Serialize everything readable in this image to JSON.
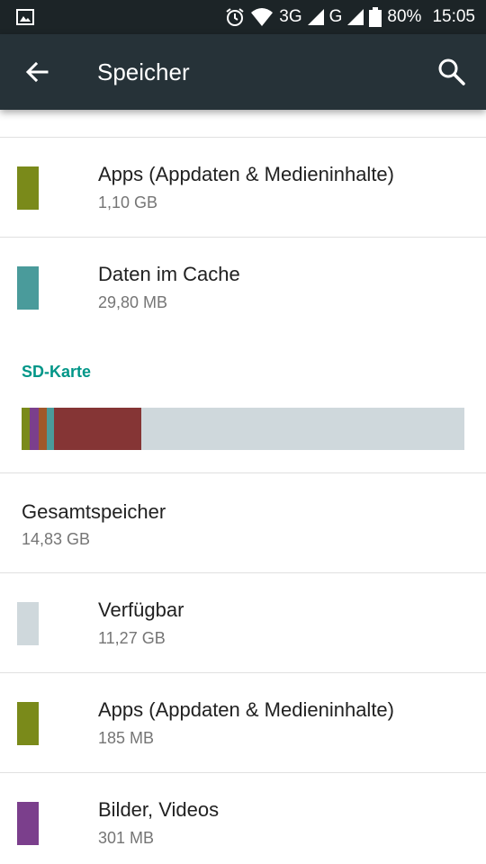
{
  "status_bar": {
    "network_3g": "3G",
    "network_g": "G",
    "battery": "80%",
    "time": "15:05"
  },
  "toolbar": {
    "title": "Speicher"
  },
  "internal": {
    "items": [
      {
        "label": "Apps (Appdaten & Medieninhalte)",
        "value": "1,10 GB",
        "color": "#7a8a1a"
      },
      {
        "label": "Daten im Cache",
        "value": "29,80 MB",
        "color": "#4a9b9b"
      }
    ]
  },
  "sd_card": {
    "header": "SD-Karte",
    "usage_bar": {
      "background": "#cfd8dc",
      "segments": [
        {
          "color": "#7a8a1a",
          "fraction": 0.018
        },
        {
          "color": "#7b3f8c",
          "fraction": 0.02
        },
        {
          "color": "#a0582a",
          "fraction": 0.018
        },
        {
          "color": "#4a9b9b",
          "fraction": 0.018
        },
        {
          "color": "#853535",
          "fraction": 0.196
        }
      ]
    },
    "total": {
      "label": "Gesamtspeicher",
      "value": "14,83 GB"
    },
    "items": [
      {
        "label": "Verfügbar",
        "value": "11,27 GB",
        "color": "#cfd8dc"
      },
      {
        "label": "Apps (Appdaten & Medieninhalte)",
        "value": "185 MB",
        "color": "#7a8a1a"
      },
      {
        "label": "Bilder, Videos",
        "value": "301 MB",
        "color": "#7b3f8c"
      }
    ]
  }
}
